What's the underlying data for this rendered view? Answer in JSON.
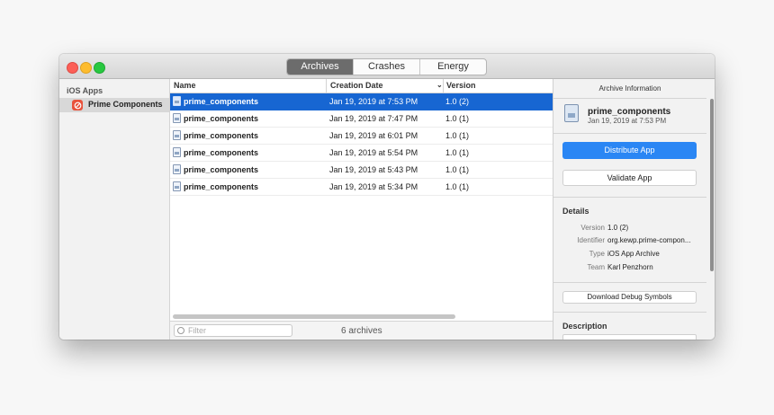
{
  "toolbar": {
    "tabs": [
      {
        "label": "Archives",
        "active": true
      },
      {
        "label": "Crashes",
        "active": false
      },
      {
        "label": "Energy",
        "active": false
      }
    ]
  },
  "sidebar": {
    "section_title": "iOS Apps",
    "items": [
      {
        "label": "Prime Components",
        "selected": true
      }
    ]
  },
  "list": {
    "columns": {
      "name": "Name",
      "date": "Creation Date",
      "version": "Version"
    },
    "rows": [
      {
        "name": "prime_components",
        "date": "Jan 19, 2019 at 7:53 PM",
        "version": "1.0 (2)",
        "selected": true
      },
      {
        "name": "prime_components",
        "date": "Jan 19, 2019 at 7:47 PM",
        "version": "1.0 (1)",
        "selected": false
      },
      {
        "name": "prime_components",
        "date": "Jan 19, 2019 at 6:01 PM",
        "version": "1.0 (1)",
        "selected": false
      },
      {
        "name": "prime_components",
        "date": "Jan 19, 2019 at 5:54 PM",
        "version": "1.0 (1)",
        "selected": false
      },
      {
        "name": "prime_components",
        "date": "Jan 19, 2019 at 5:43 PM",
        "version": "1.0 (1)",
        "selected": false
      },
      {
        "name": "prime_components",
        "date": "Jan 19, 2019 at 5:34 PM",
        "version": "1.0 (1)",
        "selected": false
      }
    ],
    "filter_placeholder": "Filter",
    "count_label": "6 archives"
  },
  "inspector": {
    "title": "Archive Information",
    "archive_name": "prime_components",
    "archive_date": "Jan 19, 2019 at 7:53 PM",
    "distribute_label": "Distribute App",
    "validate_label": "Validate App",
    "details_title": "Details",
    "details": [
      {
        "key": "Version",
        "value": "1.0 (2)"
      },
      {
        "key": "Identifier",
        "value": "org.kewp.prime-compon..."
      },
      {
        "key": "Type",
        "value": "iOS App Archive"
      },
      {
        "key": "Team",
        "value": "Karl Penzhorn"
      }
    ],
    "download_label": "Download Debug Symbols",
    "description_title": "Description"
  },
  "colors": {
    "selection": "#1766d2",
    "primary_button": "#2a86f4",
    "close": "#fc5f57",
    "minimize": "#fdbc2e",
    "zoom": "#28c840"
  }
}
